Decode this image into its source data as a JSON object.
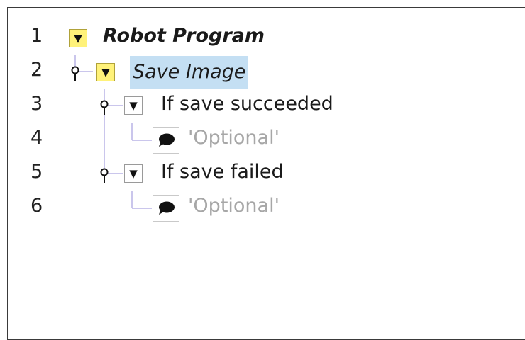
{
  "tree": {
    "rows": [
      {
        "line": "1",
        "label": "Robot Program"
      },
      {
        "line": "2",
        "label": "Save Image"
      },
      {
        "line": "3",
        "label": "If save succeeded"
      },
      {
        "line": "4",
        "label": "'Optional'"
      },
      {
        "line": "5",
        "label": "If save failed"
      },
      {
        "line": "6",
        "label": "'Optional'"
      }
    ]
  },
  "colors": {
    "selection": "#c4dff3",
    "toggle_highlight": "#fff27a",
    "comment_text": "#a7a7a7",
    "connector": "#b9b3e6"
  },
  "icons": {
    "expand_toggle": "triangle-down-icon",
    "node_pin": "pin-icon",
    "comment": "speech-bubble-icon"
  }
}
